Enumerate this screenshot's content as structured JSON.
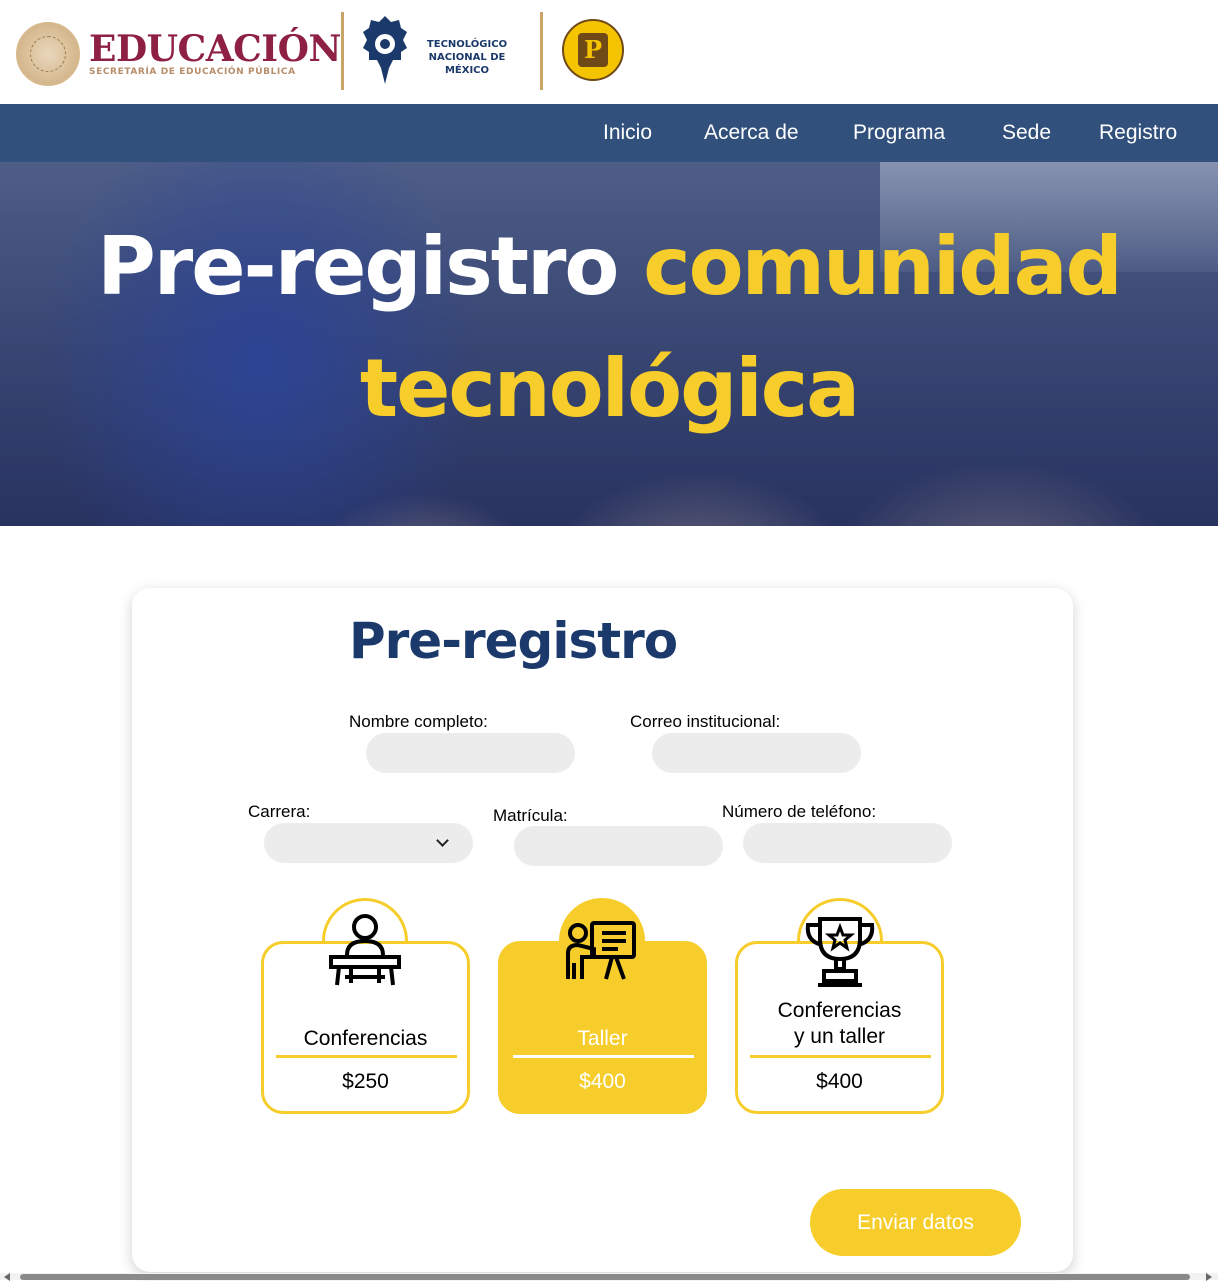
{
  "header": {
    "edu_title": "EDUCACIÓN",
    "edu_subtitle": "SECRETARÍA DE EDUCACIÓN PÚBLICA",
    "tec_line1": "TECNOLÓGICO",
    "tec_line2": "NACIONAL DE MÉXICO",
    "itp_letter": "P"
  },
  "nav": {
    "items": [
      {
        "label": "Inicio"
      },
      {
        "label": "Acerca de"
      },
      {
        "label": "Programa"
      },
      {
        "label": "Sede"
      },
      {
        "label": "Registro"
      }
    ]
  },
  "hero": {
    "title_white": "Pre-registro",
    "title_yellow_1": "comunidad",
    "title_yellow_2": "tecnológica"
  },
  "form": {
    "title": "Pre-registro",
    "fields": {
      "nombre": {
        "label": "Nombre completo:",
        "value": "",
        "placeholder": ""
      },
      "correo": {
        "label": "Correo institucional:",
        "value": "",
        "placeholder": ""
      },
      "carrera": {
        "label": "Carrera:",
        "value": ""
      },
      "matricula": {
        "label": "Matrícula:",
        "value": "",
        "placeholder": ""
      },
      "telefono": {
        "label": "Número de teléfono:",
        "value": "",
        "placeholder": ""
      }
    },
    "options": [
      {
        "name": "Conferencias",
        "price": "$250",
        "icon": "lectern-speaker-icon",
        "selected": false
      },
      {
        "name": "Taller",
        "price": "$400",
        "icon": "presentation-board-icon",
        "selected": true
      },
      {
        "name_line1": "Conferencias",
        "name_line2": "y un taller",
        "price": "$400",
        "icon": "trophy-icon",
        "selected": false
      }
    ],
    "submit_label": "Enviar datos"
  },
  "colors": {
    "nav_blue": "#32507c",
    "title_blue": "#1b396a",
    "accent_yellow": "#f6cd2a",
    "edu_maroon": "#8e2143",
    "field_gray": "#ececec"
  }
}
